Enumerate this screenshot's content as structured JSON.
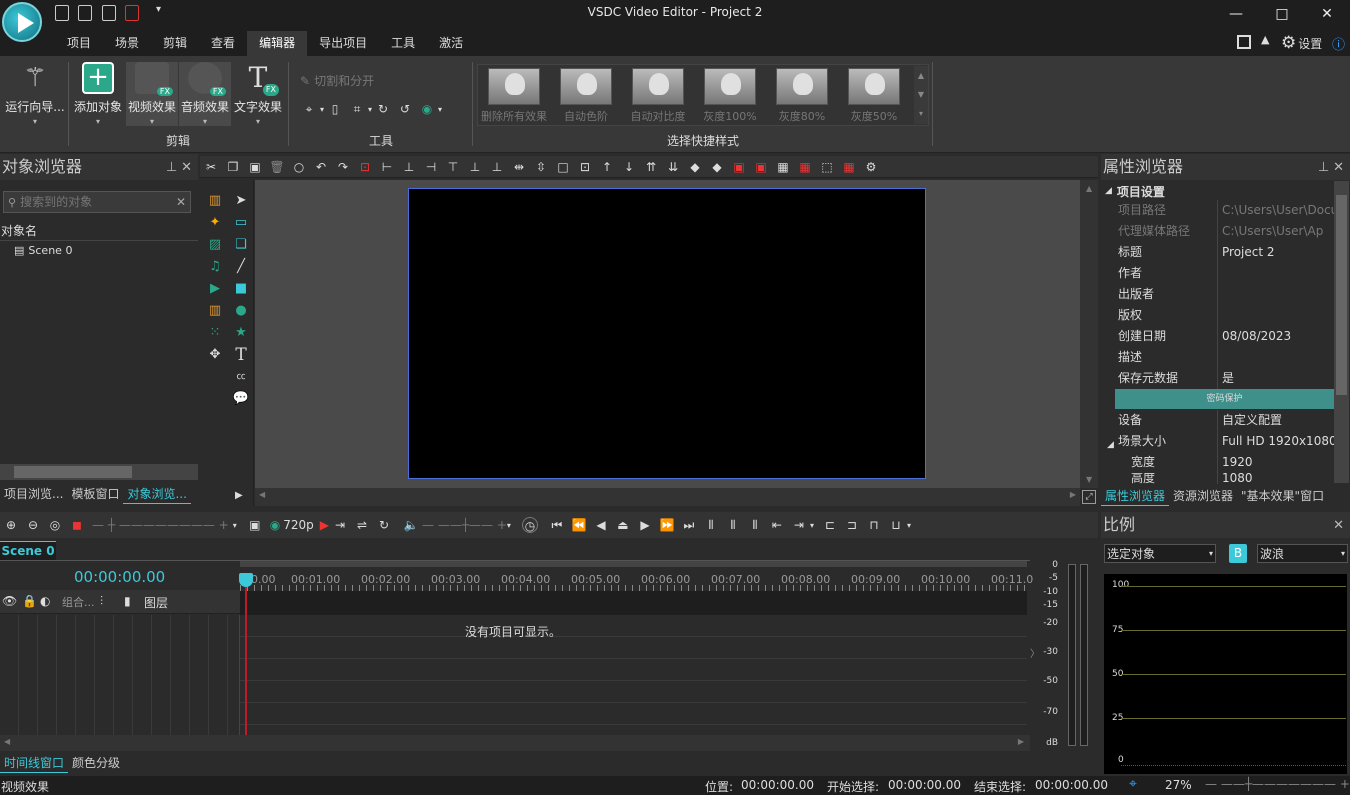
{
  "window": {
    "title": "VSDC Video Editor - Project 2",
    "minimize": "—",
    "maximize": "□",
    "close": "✕"
  },
  "quick_access": [
    "▣",
    "▣",
    "▣",
    "▣",
    "▾"
  ],
  "menu": {
    "tabs": [
      "项目",
      "场景",
      "剪辑",
      "查看",
      "编辑器",
      "导出项目",
      "工具",
      "激活"
    ],
    "active": "编辑器",
    "settings_label": "设置",
    "info": "ⓘ"
  },
  "ribbon": {
    "wizard": "运行向导...",
    "add_object": "添加对象",
    "video_effects": "视频效果",
    "audio_effects": "音频效果",
    "text_effects": "文字效果",
    "group_edit": "剪辑",
    "cut_split": "切割和分开",
    "group_tools": "工具",
    "quick_styles": [
      "删除所有效果",
      "自动色阶",
      "自动对比度",
      "灰度100%",
      "灰度80%",
      "灰度50%"
    ],
    "group_quick_styles": "选择快捷样式",
    "fx_badge": "FX"
  },
  "object_browser": {
    "title": "对象浏览器",
    "search_placeholder": "搜索到的对象",
    "column": "对象名",
    "items": [
      "Scene 0"
    ],
    "bottom_tabs": [
      "项目浏览...",
      "模板窗口",
      "对象浏览..."
    ]
  },
  "properties": {
    "title": "属性浏览器",
    "section": "项目设置",
    "rows": [
      {
        "k": "项目路径",
        "v": "C:\\Users\\User\\Docu",
        "grey": true
      },
      {
        "k": "代理媒体路径",
        "v": "C:\\Users\\User\\Ap",
        "grey": true
      },
      {
        "k": "标题",
        "v": "Project 2"
      },
      {
        "k": "作者",
        "v": ""
      },
      {
        "k": "出版者",
        "v": ""
      },
      {
        "k": "版权",
        "v": ""
      },
      {
        "k": "创建日期",
        "v": "08/08/2023"
      },
      {
        "k": "描述",
        "v": ""
      },
      {
        "k": "保存元数据",
        "v": "是"
      }
    ],
    "password_button": "密码保护",
    "rows2": [
      {
        "k": "设备",
        "v": "自定义配置"
      },
      {
        "k": "场景大小",
        "v": "Full HD 1920x1080"
      },
      {
        "k": "宽度",
        "v": "1920"
      },
      {
        "k": "高度",
        "v": "1080"
      }
    ],
    "bottom_tabs": [
      "属性浏览器",
      "资源浏览器",
      "\"基本效果\"窗口"
    ]
  },
  "scale_panel": {
    "title": "比例",
    "select": "选定对象",
    "mode_b": "B",
    "mode_select": "波浪",
    "ticks": [
      "100",
      "75",
      "50",
      "25",
      "0"
    ]
  },
  "timeline": {
    "scene_tab": "Scene 0",
    "resolution": "720p",
    "time": "00:00:00.00",
    "ruler": [
      "0.00",
      "00:01.00",
      "00:02.00",
      "00:03.00",
      "00:04.00",
      "00:05.00",
      "00:06.00",
      "00:07.00",
      "00:08.00",
      "00:09.00",
      "00:10.00",
      "00:11.0"
    ],
    "header_labels": [
      "组合...",
      "图层"
    ],
    "empty_message": "没有项目可显示。",
    "bottom_tabs": [
      "时间线窗口",
      "颜色分级"
    ],
    "meter": [
      "0",
      "-5",
      "-10",
      "-15",
      "-20",
      "-30",
      "-50",
      "-70",
      "dB"
    ]
  },
  "status_bar": {
    "left": "视频效果",
    "position_label": "位置:",
    "position": "00:00:00.00",
    "start_label": "开始选择:",
    "start": "00:00:00.00",
    "end_label": "结束选择:",
    "end": "00:00:00.00",
    "zoom": "27%"
  },
  "colors": {
    "accent": "#3cc9d9",
    "active_bg": "#3f8f8a",
    "playhead": "#c0192b"
  }
}
